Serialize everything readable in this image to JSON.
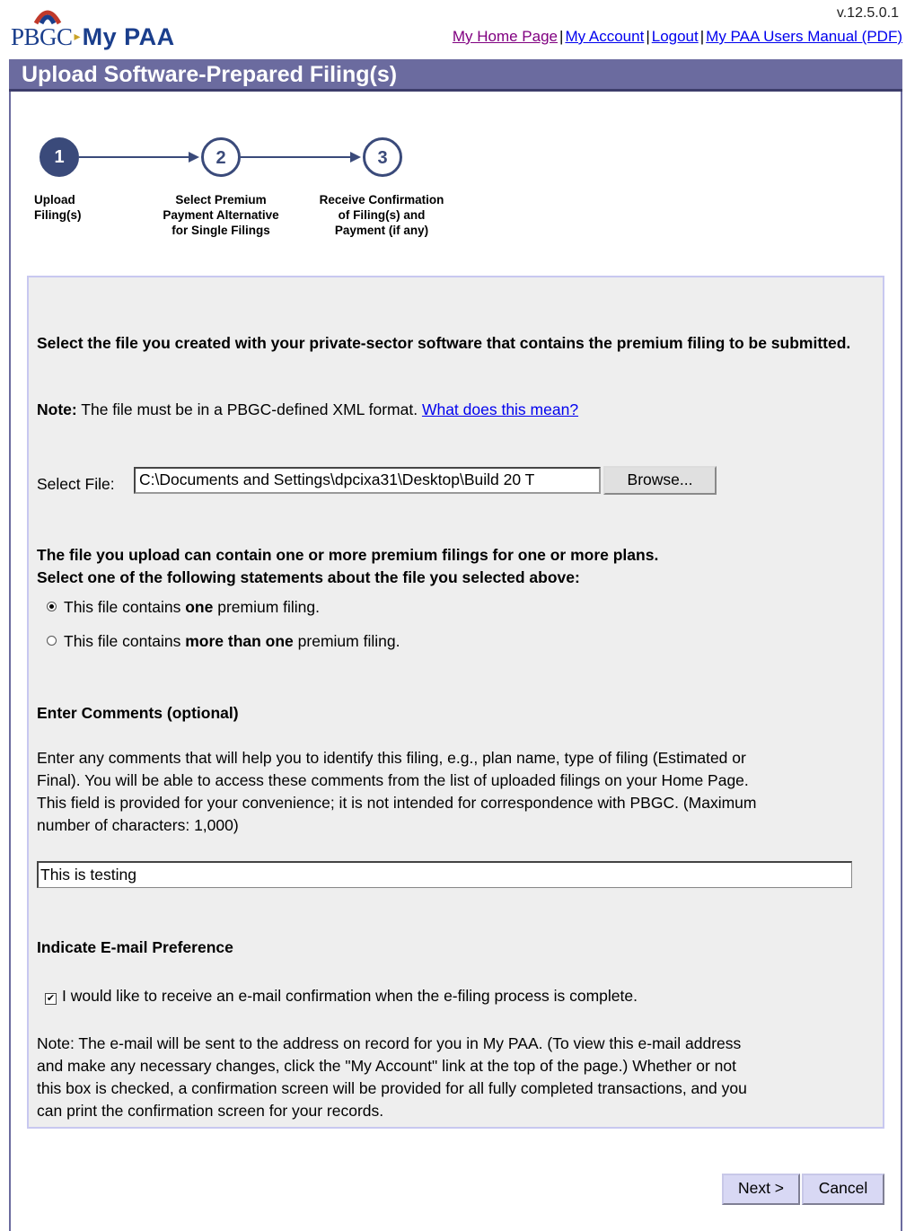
{
  "header": {
    "logo_pbgc": "PBGC",
    "logo_mypaa": "My PAA",
    "version": "v.12.5.0.1",
    "links": [
      {
        "label": "My Home Page"
      },
      {
        "label": "My Account"
      },
      {
        "label": "Logout"
      },
      {
        "label": "My PAA Users Manual (PDF)"
      }
    ],
    "separator": "|"
  },
  "page_title": "Upload Software-Prepared Filing(s)",
  "steps": [
    {
      "number": "1",
      "line1": "Upload",
      "line2": "Filing(s)",
      "line3": "",
      "state": "active"
    },
    {
      "number": "2",
      "line1": "Select Premium",
      "line2": "Payment Alternative",
      "line3": "for Single Filings",
      "state": "pending"
    },
    {
      "number": "3",
      "line1": "Receive Confirmation",
      "line2": "of Filing(s) and",
      "line3": "Payment (if any)",
      "state": "pending"
    }
  ],
  "form": {
    "instruction": "Select the file you created with your private-sector software that contains the premium filing to be submitted.",
    "note_label": "Note:",
    "note_text": "The file must be in a PBGC-defined XML format.",
    "note_link": "What does this mean?",
    "file_label": "Select File:",
    "file_value": "C:\\Documents and Settings\\dpcixa31\\Desktop\\Build 20 T",
    "browse_label": "Browse...",
    "file_contents_heading_1": "The file you upload can contain one or more premium filings for one or more plans.",
    "file_contents_heading_2": "Select one of the following statements about the file you selected above:",
    "radio_one_pre": "This file contains",
    "radio_one_bold": "one",
    "radio_one_post": "premium filing.",
    "radio_more_pre": "This file contains",
    "radio_more_bold": "more than one",
    "radio_more_post": "premium filing.",
    "comments_heading": "Enter Comments (optional)",
    "comments_help_1": "Enter any comments that will help you to identify this filing, e.g., plan name, type of filing (Estimated or",
    "comments_help_2": "Final). You will be able to access these comments from the list of uploaded filings on your Home Page.",
    "comments_help_3": "This field is provided for your convenience; it is not intended for correspondence with PBGC. (Maximum",
    "comments_help_4": "number of characters: 1,000)",
    "comments_value": "This is testing",
    "email_heading": "Indicate E-mail Preference",
    "email_checkbox_label": "I would like to receive an e-mail confirmation when the e-filing process is complete.",
    "email_note_1": "Note: The e-mail will be sent to the address on record for you in My PAA. (To view this e-mail address",
    "email_note_2": "and make any necessary changes, click the \"My Account\" link at the top of the page.) Whether or not",
    "email_note_3": "this box is checked, a confirmation screen will be provided for all fully completed transactions, and you",
    "email_note_4": "can print the confirmation screen for your records."
  },
  "buttons": {
    "next": "Next >",
    "cancel": "Cancel"
  },
  "colors": {
    "title_bar": "#6b6b9f",
    "panel_bg": "#eeeeee",
    "panel_border": "#c8c8f0",
    "step_active": "#3a4a7a",
    "link": "#0000ee"
  }
}
